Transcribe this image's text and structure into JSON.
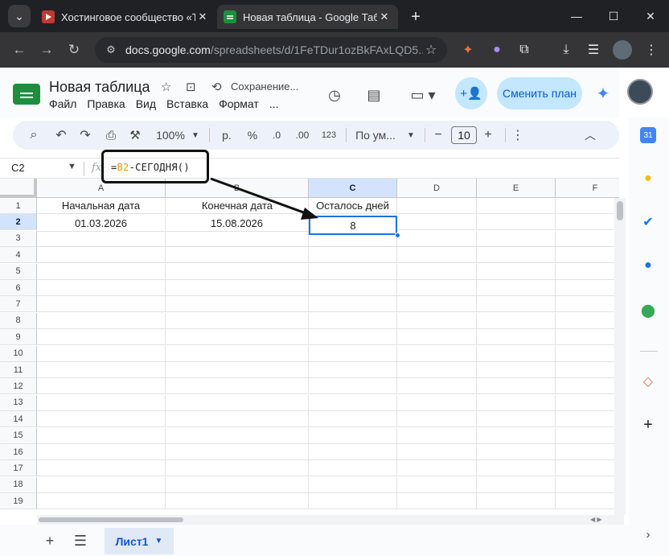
{
  "browser": {
    "tabs": [
      {
        "title": "Хостинговое сообщество «Tim",
        "favicon": "youtube-icon",
        "active": false
      },
      {
        "title": "Новая таблица - Google Табли",
        "favicon": "sheets-icon",
        "active": true
      }
    ],
    "new_tab": "+",
    "url_host": "docs.google.com",
    "url_path": "/spreadsheets/d/1FeTDur1ozBkFAxLQD5..."
  },
  "doc": {
    "title": "Новая таблица",
    "save_status": "Сохранение...",
    "menu": [
      "Файл",
      "Правка",
      "Вид",
      "Вставка",
      "Формат",
      "..."
    ],
    "plan_button": "Сменить план"
  },
  "toolbar": {
    "zoom": "100%",
    "currency": "р.",
    "percent": "%",
    "decrease_decimals": ".0",
    "increase_decimals": ".00",
    "number_format": "123",
    "font": "По ум...",
    "minus": "−",
    "font_size": "10",
    "plus": "+"
  },
  "formula_bar": {
    "name_box": "C2",
    "fx": "fx",
    "formula_prefix": "=",
    "formula_ref": "B2",
    "formula_rest": "-СЕГОДНЯ()"
  },
  "grid": {
    "columns": [
      "A",
      "B",
      "C",
      "D",
      "E",
      "F"
    ],
    "rows": [
      "1",
      "2",
      "3",
      "4",
      "5",
      "6",
      "7",
      "8",
      "9",
      "10",
      "11",
      "12",
      "13",
      "14",
      "15",
      "16",
      "17",
      "18",
      "19"
    ],
    "cells": {
      "A1": "Начальная дата",
      "B1": "Конечная дата",
      "C1": "Осталось дней",
      "A2": "01.03.2026",
      "B2": "15.08.2026",
      "C2": "8"
    },
    "active_cell": "C2"
  },
  "sheet_bar": {
    "add": "+",
    "sheet_name": "Лист1"
  },
  "side_panel": {
    "calendar_label": "31"
  },
  "colors": {
    "accent": "#1a73e8",
    "sheets_green": "#1e8e3e",
    "formula_ref": "#f29900"
  }
}
